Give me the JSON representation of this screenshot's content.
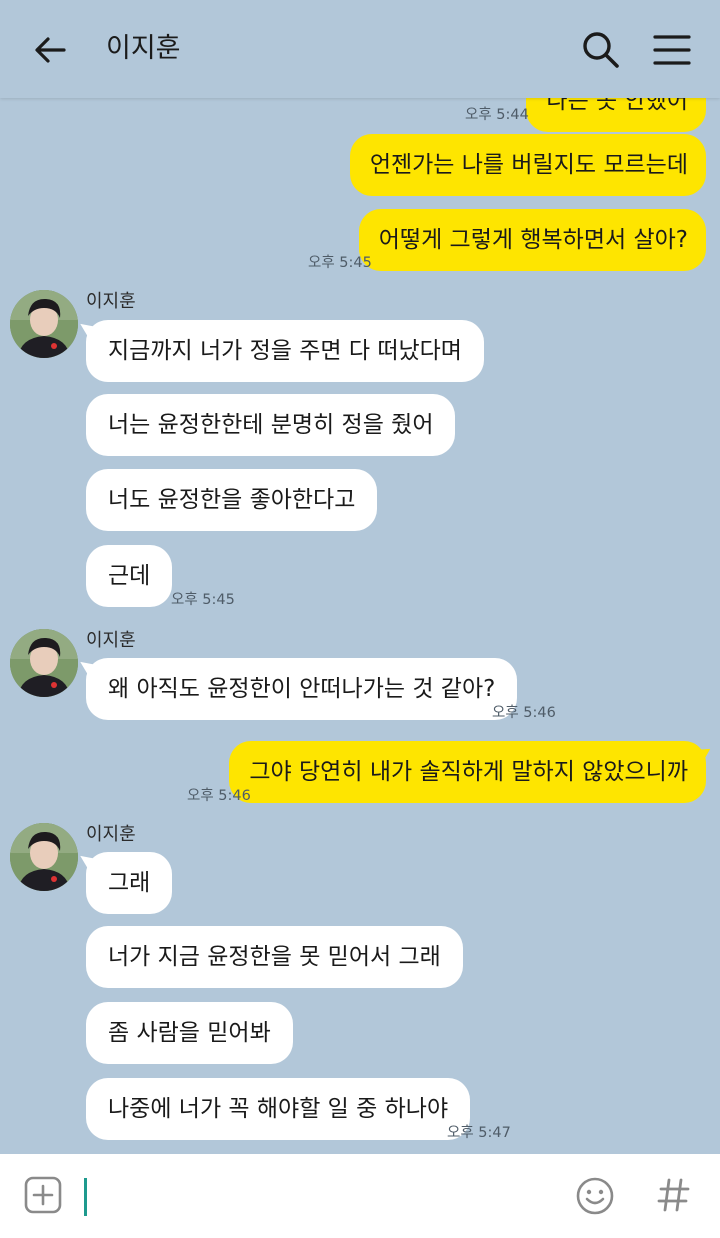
{
  "header": {
    "title": "이지훈"
  },
  "contact_name": "이지훈",
  "messages": {
    "m0_partial": "나는 못 안했어",
    "m1": "언젠가는 나를 버릴지도 모르는데",
    "m2": "어떻게 그렇게 행복하면서 살아?",
    "m3": "지금까지 너가 정을 주면 다 떠났다며",
    "m4": "너는 윤정한한테 분명히 정을 줬어",
    "m5": "너도 윤정한을 좋아한다고",
    "m6": "근데",
    "m7": "왜 아직도 윤정한이 안떠나가는 것 같아?",
    "m8": "그야 당연히 내가 솔직하게 말하지 않았으니까",
    "m9": "그래",
    "m10": "너가 지금 윤정한을 못 믿어서 그래",
    "m11": "좀 사람을 믿어봐",
    "m12": "나중에 너가 꼭 해야할 일 중 하나야"
  },
  "times": {
    "t0": "오후 5:44",
    "t1": "오후 5:45",
    "t2": "오후 5:45",
    "t3": "오후 5:46",
    "t4": "오후 5:46",
    "t5": "오후 5:47"
  },
  "input": {
    "value": ""
  },
  "colors": {
    "background": "#b2c7d9",
    "my_bubble": "#fee500",
    "their_bubble": "#ffffff",
    "caret": "#1e9a8e"
  },
  "icons": [
    "back-arrow-icon",
    "search-icon",
    "menu-icon",
    "plus-icon",
    "emoji-icon",
    "hashtag-icon"
  ]
}
